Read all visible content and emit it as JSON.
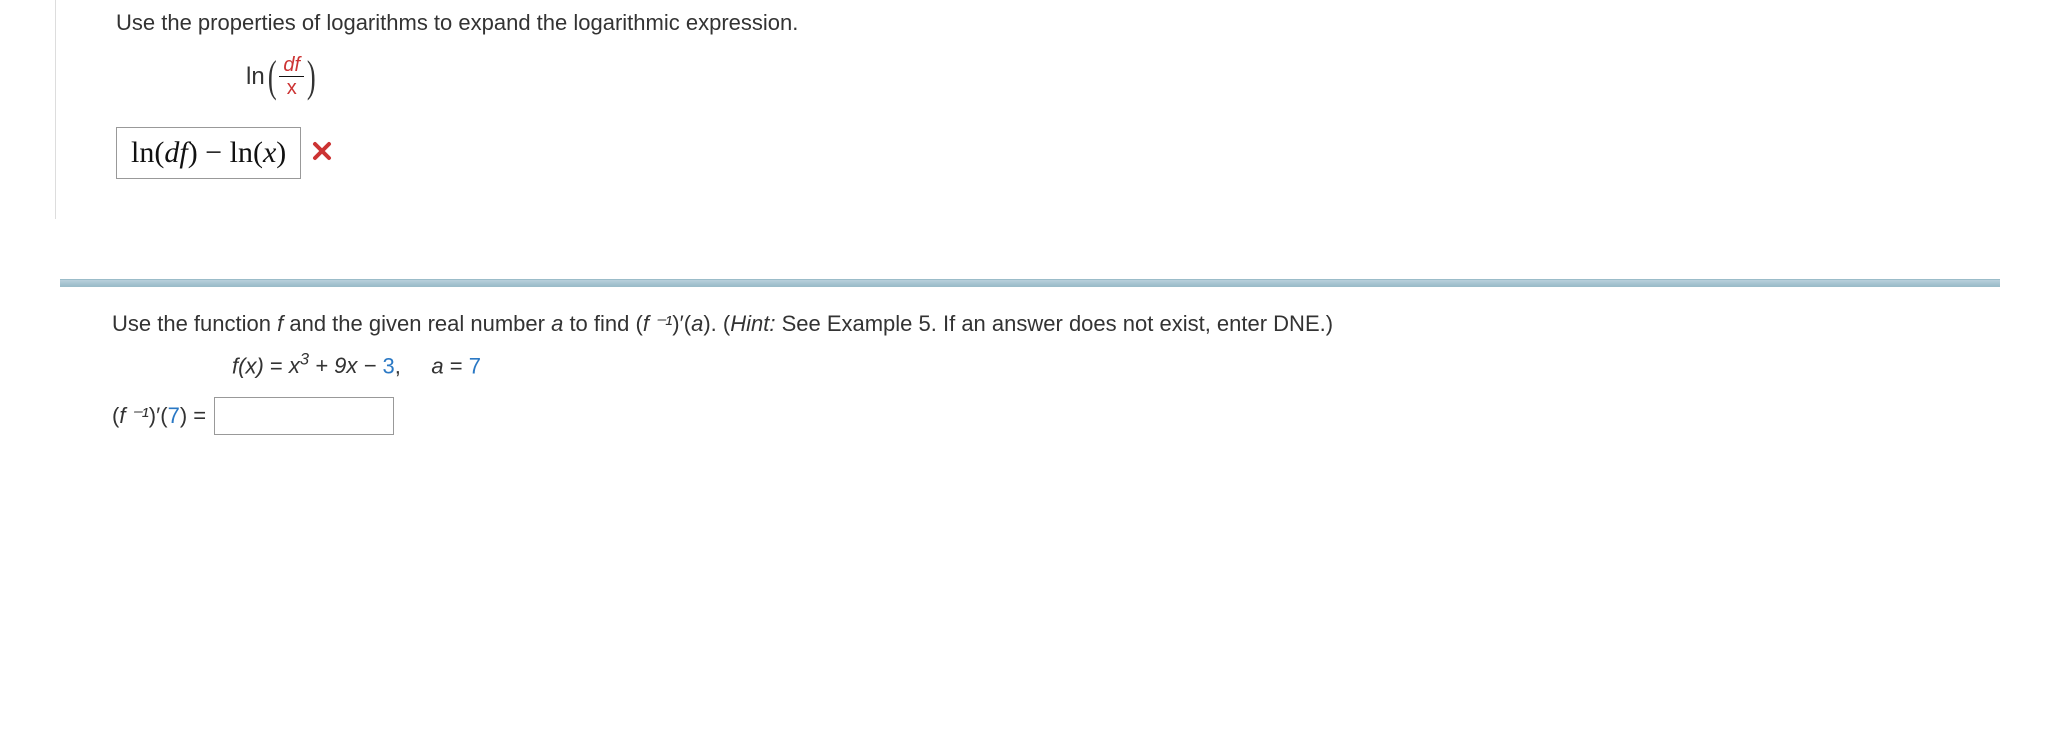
{
  "q1": {
    "prompt": "Use the properties of logarithms to expand the logarithmic expression.",
    "ln_label": "ln",
    "frac_num": "df",
    "frac_den": "x",
    "submitted_answer": "ln(df) − ln(x)",
    "feedback_icon": "wrong-icon"
  },
  "q2": {
    "prompt_before": "Use the function ",
    "prompt_f": "f",
    "prompt_mid1": " and the given real number ",
    "prompt_a": "a",
    "prompt_mid2": " to find  (",
    "prompt_finv": "f ⁻¹",
    "prompt_mid3": ")′(",
    "prompt_a2": "a",
    "prompt_mid4": ").  (",
    "hint_label": "Hint:",
    "hint_text": " See Example 5. If an answer does not exist, enter DNE.)",
    "func_lhs": "f(x)",
    "func_eq": " = ",
    "func_rhs_black": "x³ + 9x − ",
    "func_rhs_blue": "3",
    "func_comma": ",     ",
    "a_lhs": "a",
    "a_eq": " = ",
    "a_val": "7",
    "answer_label_pre": "(",
    "answer_label_finv": "f ⁻¹",
    "answer_label_mid": ")′(",
    "answer_label_arg": "7",
    "answer_label_post": ") =",
    "answer_value": ""
  }
}
